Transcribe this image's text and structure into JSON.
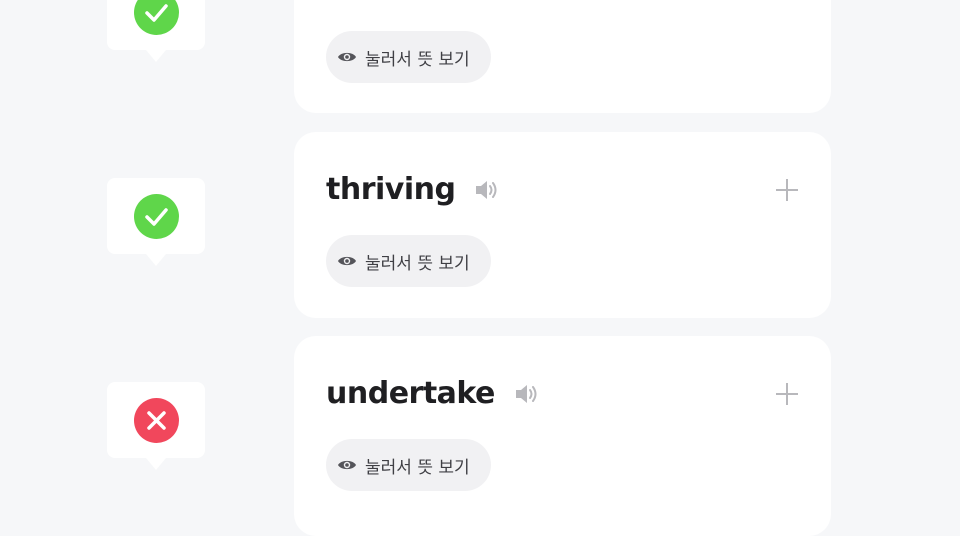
{
  "items": [
    {
      "word": "",
      "status": "correct",
      "reveal_label": "눌러서 뜻 보기"
    },
    {
      "word": "thriving",
      "status": "correct",
      "reveal_label": "눌러서 뜻 보기"
    },
    {
      "word": "undertake",
      "status": "incorrect",
      "reveal_label": "눌러서 뜻 보기"
    }
  ],
  "icons": {
    "correct": "check-icon",
    "incorrect": "x-icon",
    "speaker": "speaker-icon",
    "add": "plus-icon",
    "reveal": "eye-icon"
  },
  "colors": {
    "page_bg": "#f6f7f9",
    "card_bg": "#ffffff",
    "correct": "#5fd64a",
    "incorrect": "#f1475c",
    "word_text": "#1f1f22",
    "pill_bg": "#f1f1f3",
    "icon_gray": "#b8b8bc"
  }
}
